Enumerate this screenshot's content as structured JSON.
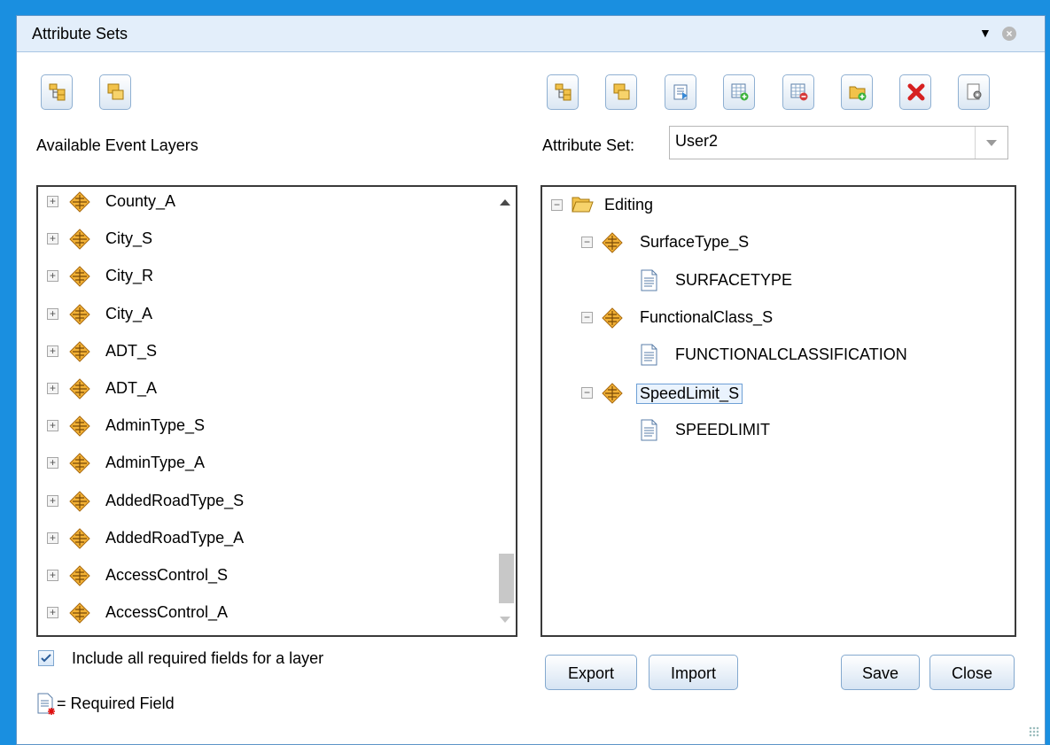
{
  "window": {
    "title": "Attribute Sets"
  },
  "left": {
    "heading": "Available Event Layers",
    "items": [
      {
        "label": "County_A"
      },
      {
        "label": "City_S"
      },
      {
        "label": "City_R"
      },
      {
        "label": "City_A"
      },
      {
        "label": "ADT_S"
      },
      {
        "label": "ADT_A"
      },
      {
        "label": "AdminType_S"
      },
      {
        "label": "AdminType_A"
      },
      {
        "label": "AddedRoadType_S"
      },
      {
        "label": "AddedRoadType_A"
      },
      {
        "label": "AccessControl_S"
      },
      {
        "label": "AccessControl_A"
      }
    ],
    "include_required_label": "Include all required fields for a layer",
    "include_required_checked": true,
    "legend_label": "= Required Field"
  },
  "right": {
    "attribute_set_label": "Attribute Set:",
    "attribute_set_value": "User2",
    "tree": [
      {
        "label": "Editing",
        "kind": "folder",
        "expanded": true
      },
      {
        "label": "SurfaceType_S",
        "kind": "layer",
        "expanded": true
      },
      {
        "label": "SURFACETYPE",
        "kind": "field"
      },
      {
        "label": "FunctionalClass_S",
        "kind": "layer",
        "expanded": true
      },
      {
        "label": "FUNCTIONALCLASSIFICATION",
        "kind": "field"
      },
      {
        "label": "SpeedLimit_S",
        "kind": "layer",
        "expanded": true,
        "selected": true
      },
      {
        "label": "SPEEDLIMIT",
        "kind": "field"
      }
    ]
  },
  "buttons": {
    "export": "Export",
    "import": "Import",
    "save": "Save",
    "close": "Close"
  },
  "icons": {
    "left_toolbar": [
      "expand-all-icon",
      "collapse-all-icon"
    ],
    "right_toolbar": [
      "expand-all-icon",
      "collapse-all-icon",
      "rename-icon",
      "add-table-icon",
      "remove-table-icon",
      "add-folder-icon",
      "delete-icon",
      "settings-icon"
    ]
  },
  "colors": {
    "accent": "#1a8fe0",
    "icon_orange": "#e3a020",
    "delete_red": "#d62020"
  }
}
